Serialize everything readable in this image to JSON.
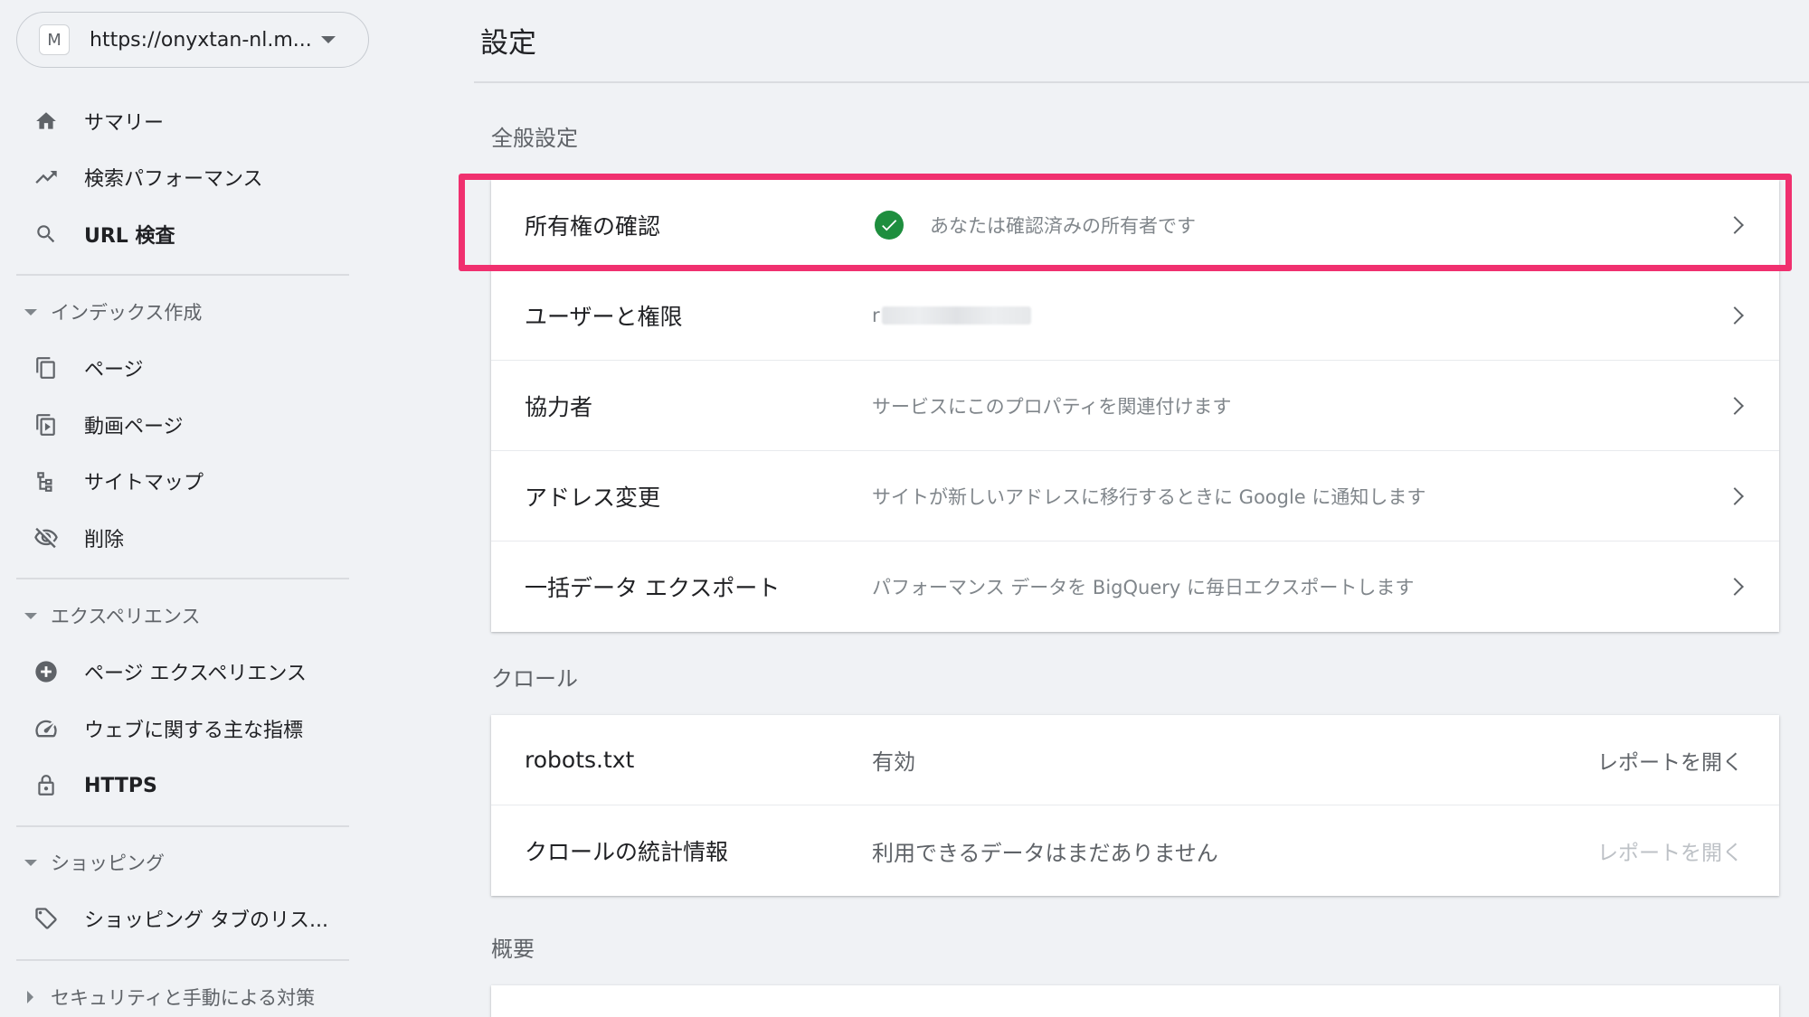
{
  "property": {
    "avatar_letter": "M",
    "url": "https://onyxtan-nl.m..."
  },
  "sidebar": {
    "top_items": [
      {
        "label": "サマリー",
        "icon": "home-icon"
      },
      {
        "label": "検索パフォーマンス",
        "icon": "trending-up-icon"
      },
      {
        "label": "URL 検査",
        "icon": "search-icon"
      }
    ],
    "sections": [
      {
        "label": "インデックス作成",
        "items": [
          {
            "label": "ページ",
            "icon": "pages-icon"
          },
          {
            "label": "動画ページ",
            "icon": "video-pages-icon"
          },
          {
            "label": "サイトマップ",
            "icon": "sitemap-icon"
          },
          {
            "label": "削除",
            "icon": "eye-off-icon"
          }
        ]
      },
      {
        "label": "エクスペリエンス",
        "items": [
          {
            "label": "ページ エクスペリエンス",
            "icon": "plus-circle-icon"
          },
          {
            "label": "ウェブに関する主な指標",
            "icon": "speed-gauge-icon"
          },
          {
            "label": "HTTPS",
            "icon": "lock-icon"
          }
        ]
      },
      {
        "label": "ショッピング",
        "items": [
          {
            "label": "ショッピング タブのリス...",
            "icon": "tag-icon"
          }
        ]
      },
      {
        "label": "セキュリティと手動による対策",
        "items": []
      }
    ]
  },
  "main": {
    "title": "設定",
    "general": {
      "heading": "全般設定",
      "rows": [
        {
          "title": "所有権の確認",
          "desc": "あなたは確認済みの所有者です",
          "status_icon": "check-circle-icon"
        },
        {
          "title": "ユーザーと権限",
          "desc": "r"
        },
        {
          "title": "協力者",
          "desc": "サービスにこのプロパティを関連付けます"
        },
        {
          "title": "アドレス変更",
          "desc": "サイトが新しいアドレスに移行するときに Google に通知します"
        },
        {
          "title": "一括データ エクスポート",
          "desc": "パフォーマンス データを BigQuery に毎日エクスポートします"
        }
      ]
    },
    "crawl": {
      "heading": "クロール",
      "rows": [
        {
          "title": "robots.txt",
          "desc": "有効",
          "link": "レポートを開く",
          "link_enabled": true
        },
        {
          "title": "クロールの統計情報",
          "desc": "利用できるデータはまだありません",
          "link": "レポートを開く",
          "link_enabled": false
        }
      ]
    },
    "overview": {
      "heading": "概要"
    }
  },
  "colors": {
    "highlight": "#f0306f",
    "verified_green": "#1e8e3e",
    "background": "#f0f2f5"
  }
}
